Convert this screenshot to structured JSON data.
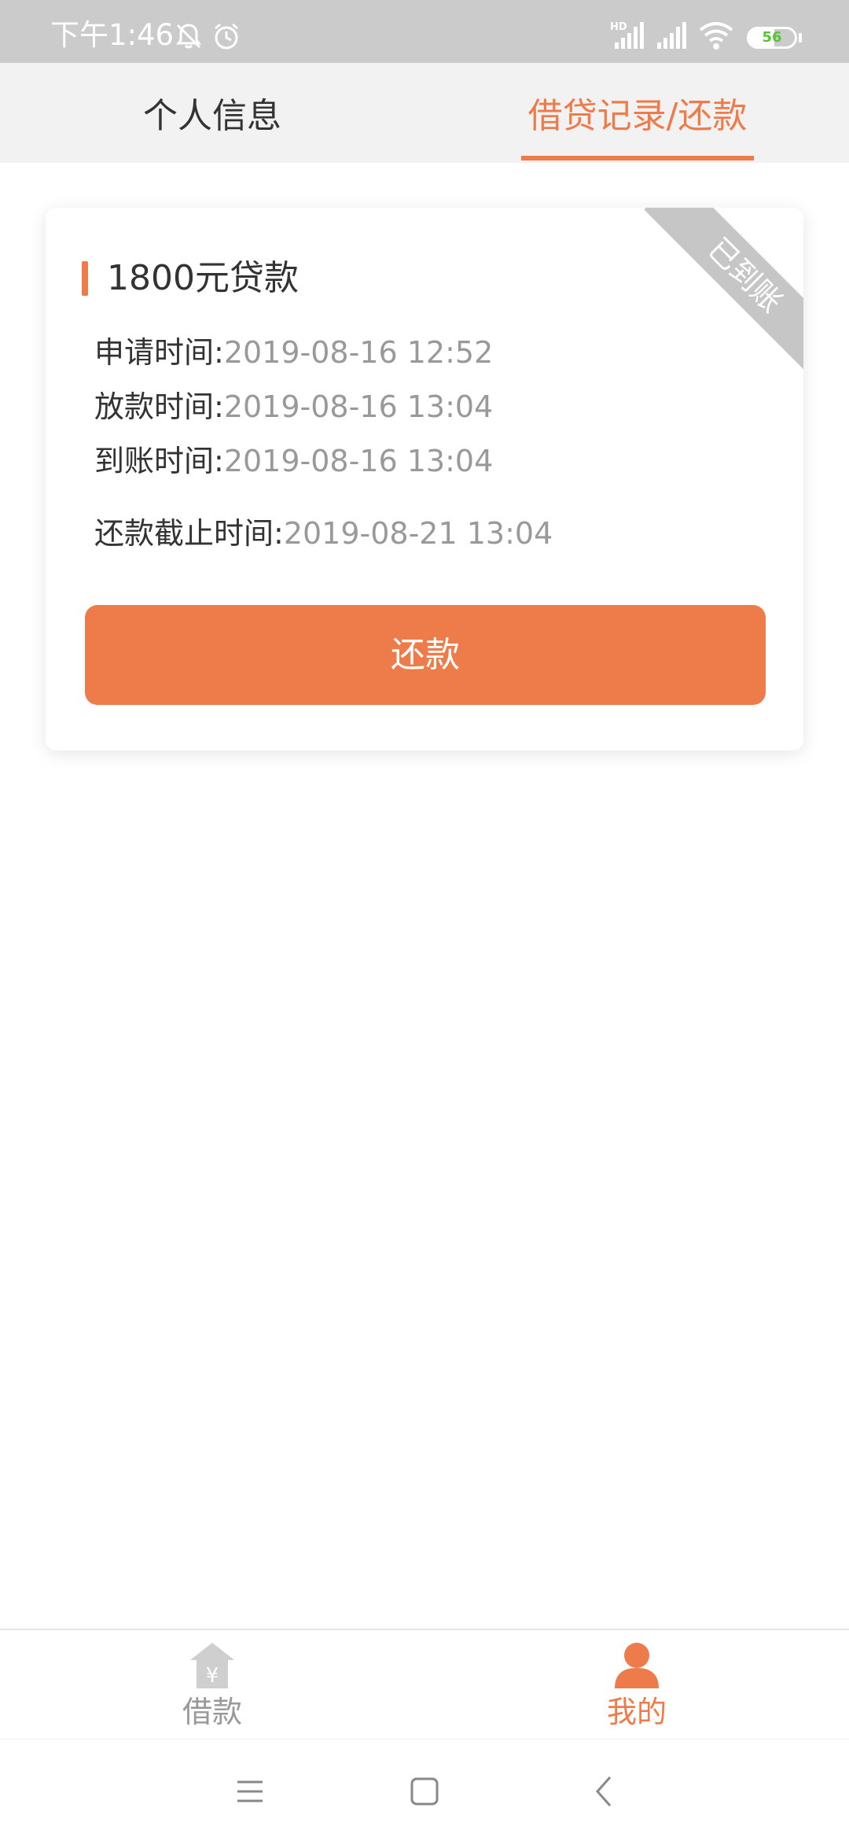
{
  "status_bar": {
    "time": "下午1:46",
    "network_badge": "HD",
    "battery": "56",
    "icons": [
      "mute-bell-icon",
      "alarm-icon",
      "signal-hd-icon",
      "signal-icon",
      "wifi-icon",
      "battery-icon"
    ]
  },
  "tabs": [
    {
      "label": "个人信息",
      "active": false
    },
    {
      "label": "借贷记录/还款",
      "active": true
    }
  ],
  "loan_card": {
    "title": "1800元贷款",
    "status_ribbon": "已到账",
    "rows": [
      {
        "label": "申请时间:",
        "value": "2019-08-16 12:52"
      },
      {
        "label": "放款时间:",
        "value": "2019-08-16 13:04"
      },
      {
        "label": "到账时间:",
        "value": "2019-08-16 13:04"
      },
      {
        "label": "还款截止时间:",
        "value": "2019-08-21 13:04"
      }
    ],
    "repay_button": "还款"
  },
  "bottom_nav": [
    {
      "label": "借款",
      "icon": "house-yuan-icon",
      "active": false
    },
    {
      "label": "我的",
      "icon": "person-icon",
      "active": true
    }
  ],
  "colors": {
    "accent": "#ee7c4a",
    "status_bar_bg": "#cbcbcb",
    "tab_bar_bg": "#f2f2f2",
    "ribbon": "#c6c6c6",
    "value_text": "#999999",
    "inactive_nav": "#999999",
    "battery_fill": "#5ac33a"
  }
}
